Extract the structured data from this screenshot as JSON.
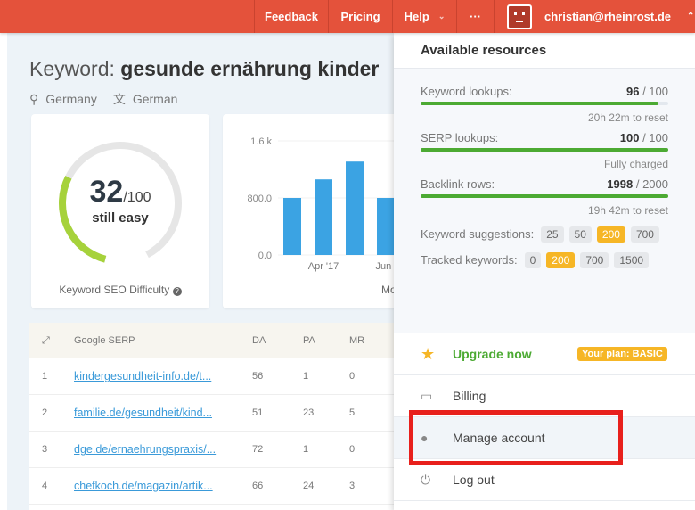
{
  "topbar": {
    "feedback": "Feedback",
    "pricing": "Pricing",
    "help": "Help",
    "more": "···",
    "email": "christian@rheinrost.de",
    "brand_color": "#e4523b"
  },
  "keyword": {
    "label": "Keyword:",
    "value": "gesunde ernährung kinder",
    "country": "Germany",
    "language": "German"
  },
  "difficulty": {
    "score": "32",
    "max": "/100",
    "verdict": "still easy",
    "label": "Keyword SEO Difficulty",
    "value": 32,
    "color": "#a6d23b"
  },
  "chart_data": {
    "type": "bar",
    "yticks": [
      "1.6 k",
      "800.0",
      "0.0"
    ],
    "ylim": [
      0,
      1600
    ],
    "values": [
      800,
      1060,
      1310,
      800
    ],
    "xticks": [
      "Apr '17",
      "Jun '"
    ],
    "caption": "Mo",
    "color": "#3ba3e3"
  },
  "table": {
    "headers": [
      "Google SERP",
      "DA",
      "PA",
      "MR"
    ],
    "rows": [
      {
        "n": "1",
        "url": "kindergesundheit-info.de/t...",
        "da": "56",
        "pa": "1",
        "mr": "0"
      },
      {
        "n": "2",
        "url": "familie.de/gesundheit/kind...",
        "da": "51",
        "pa": "23",
        "mr": "5"
      },
      {
        "n": "3",
        "url": "dge.de/ernaehrungspraxis/...",
        "da": "72",
        "pa": "1",
        "mr": "0"
      },
      {
        "n": "4",
        "url": "chefkoch.de/magazin/artik...",
        "da": "66",
        "pa": "24",
        "mr": "3"
      }
    ]
  },
  "panel": {
    "title": "Available resources",
    "resources": [
      {
        "label": "Keyword lookups:",
        "used": "96",
        "total": "/ 100",
        "note": "20h 22m to reset",
        "pct": 96
      },
      {
        "label": "SERP lookups:",
        "used": "100",
        "total": "/ 100",
        "note": "Fully charged",
        "pct": 100
      },
      {
        "label": "Backlink rows:",
        "used": "1998",
        "total": "/ 2000",
        "note": "19h 42m to reset",
        "pct": 99.9
      }
    ],
    "suggestions": {
      "label": "Keyword suggestions:",
      "options": [
        "25",
        "50",
        "200",
        "700"
      ]
    },
    "tracked": {
      "label": "Tracked keywords:",
      "options": [
        "0",
        "200",
        "700",
        "1500"
      ]
    },
    "upgrade": "Upgrade now",
    "plan": "Your plan: BASIC",
    "billing": "Billing",
    "manage": "Manage account",
    "logout": "Log out"
  }
}
